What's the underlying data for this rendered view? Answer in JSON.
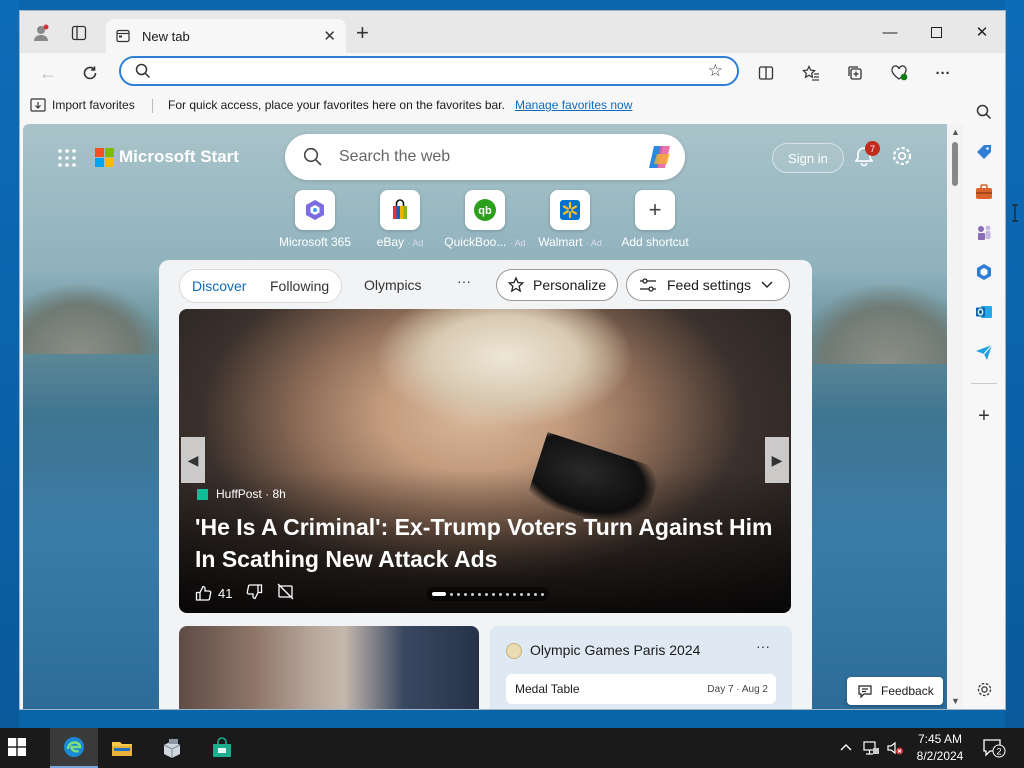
{
  "tab": {
    "title": "New tab"
  },
  "address": {
    "value": "",
    "placeholder": ""
  },
  "favorites_bar": {
    "import_label": "Import favorites",
    "message": "For quick access, place your favorites here on the favorites bar.",
    "link": "Manage favorites now"
  },
  "start": {
    "brand": "Microsoft Start",
    "search_placeholder": "Search the web",
    "signin": "Sign in",
    "notifications_count": "7"
  },
  "shortcuts": [
    {
      "label": "Microsoft 365",
      "ad": ""
    },
    {
      "label": "eBay",
      "ad": "· Ad"
    },
    {
      "label": "QuickBoo...",
      "ad": "· Ad"
    },
    {
      "label": "Walmart",
      "ad": "· Ad"
    },
    {
      "label": "Add shortcut",
      "ad": ""
    }
  ],
  "feed_nav": {
    "discover": "Discover",
    "following": "Following",
    "olympics": "Olympics",
    "more": "···",
    "personalize": "Personalize",
    "feed_settings": "Feed settings"
  },
  "hero": {
    "source": "HuffPost · 8h",
    "title": "'He Is A Criminal': Ex-Trump Voters Turn Against Him In Scathing New Attack Ads",
    "likes": "41",
    "slide_count": 15,
    "active_slide": 1
  },
  "olympic_card": {
    "title": "Olympic Games Paris 2024",
    "more": "···",
    "medal_table": "Medal Table",
    "day": "Day 7 · Aug 2"
  },
  "feedback": "Feedback",
  "clock": {
    "time": "7:45 AM",
    "date": "8/2/2024"
  },
  "notifications_badge": "2",
  "colors": {
    "accent": "#0f6cbd",
    "address_border": "#2f7fd6",
    "badge": "#c42b1c"
  }
}
